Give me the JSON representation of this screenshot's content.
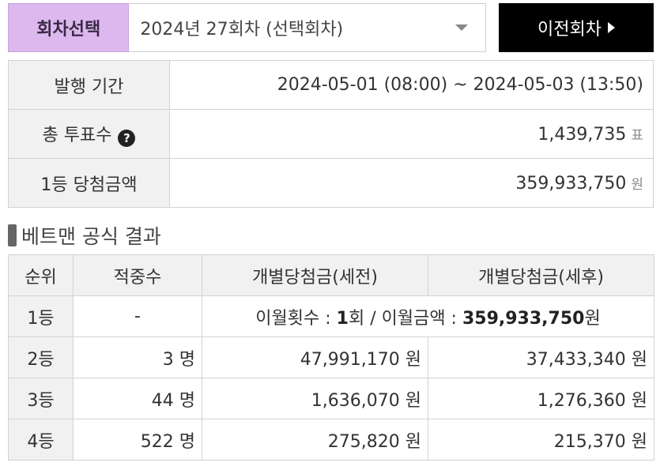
{
  "selector": {
    "label": "회차선택",
    "selected": "2024년 27회차 (선택회차)",
    "prev_button": "이전회차"
  },
  "info": {
    "period_label": "발행 기간",
    "period_value": "2024-05-01 (08:00) ~ 2024-05-03 (13:50)",
    "votes_label": "총 투표수",
    "votes_value": "1,439,735",
    "votes_unit": "표",
    "first_prize_label": "1등 당첨금액",
    "first_prize_value": "359,933,750",
    "first_prize_unit": "원"
  },
  "section_title": "베트맨 공식 결과",
  "results": {
    "headers": [
      "순위",
      "적중수",
      "개별당첨금(세전)",
      "개별당첨금(세후)"
    ],
    "first": {
      "rank": "1등",
      "hits": "-",
      "rollover_count_label": "이월횟수 : ",
      "rollover_count": "1",
      "rollover_count_unit": "회 / 이월금액 : ",
      "rollover_amount": "359,933,750",
      "rollover_amount_unit": "원"
    },
    "rows": [
      {
        "rank": "2등",
        "hits": "3 명",
        "pre_tax": "47,991,170 원",
        "post_tax": "37,433,340 원"
      },
      {
        "rank": "3등",
        "hits": "44 명",
        "pre_tax": "1,636,070 원",
        "post_tax": "1,276,360 원"
      },
      {
        "rank": "4등",
        "hits": "522 명",
        "pre_tax": "275,820 원",
        "post_tax": "215,370 원"
      }
    ]
  }
}
